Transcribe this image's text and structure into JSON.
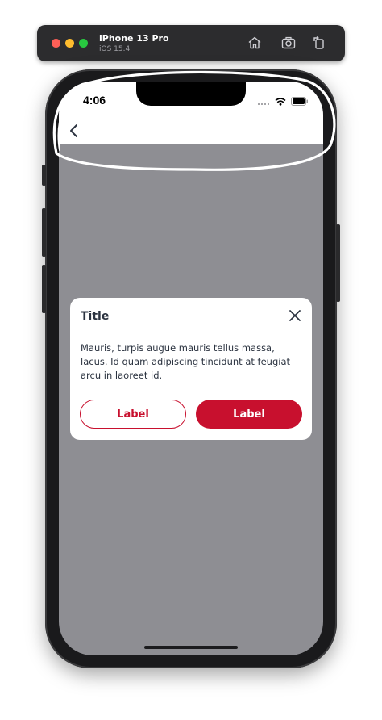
{
  "simulator": {
    "device_name": "iPhone 13 Pro",
    "os_version": "iOS 15.4",
    "toolbar_icons": [
      "home-icon",
      "screenshot-icon",
      "rotate-icon"
    ]
  },
  "status_bar": {
    "time": "4:06",
    "icons": [
      "signal-icon",
      "wifi-icon",
      "battery-icon"
    ]
  },
  "nav_bar": {
    "back_icon": "chevron-left-icon"
  },
  "dialog": {
    "title": "Title",
    "body": "Mauris, turpis augue mauris tellus massa, lacus. Id quam adipiscing tincidunt at feugiat arcu in laoreet id.",
    "secondary_label": "Label",
    "primary_label": "Label",
    "close_icon": "close-icon"
  },
  "colors": {
    "accent": "#c8102e",
    "overlay": "#8e8e93",
    "text": "#2b3340",
    "annotation": "#ffffff"
  }
}
